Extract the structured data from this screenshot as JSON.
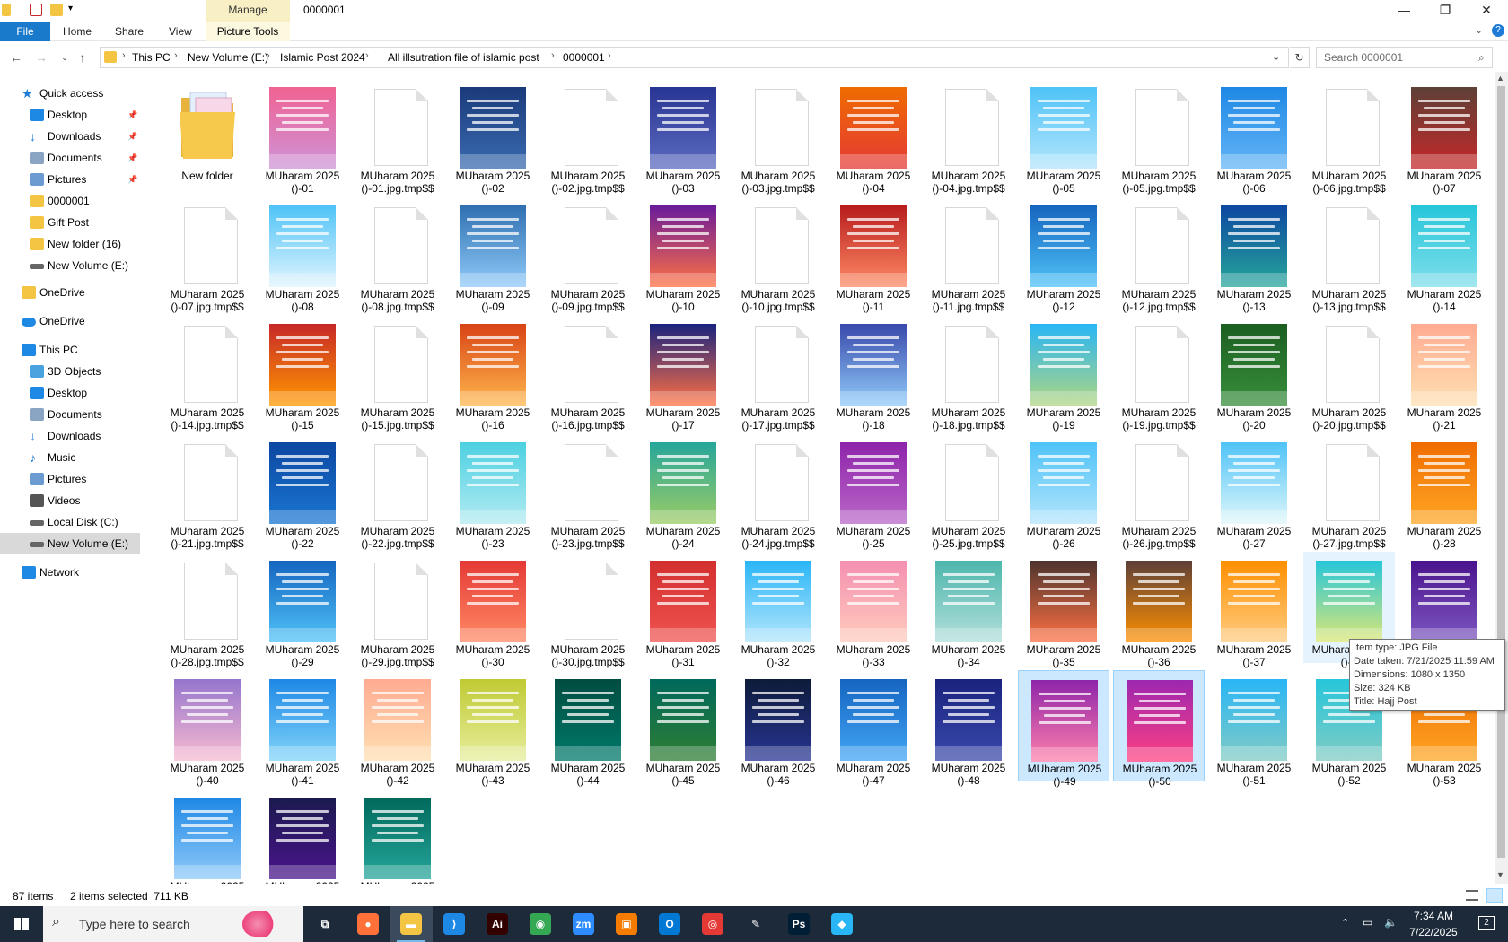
{
  "window": {
    "manage_tab": "Manage",
    "title": "0000001",
    "minimize": "—",
    "maximize": "❐",
    "close": "✕"
  },
  "ribbon": {
    "file": "File",
    "home": "Home",
    "share": "Share",
    "view": "View",
    "picture_tools": "Picture Tools"
  },
  "address": {
    "crumbs": [
      "This PC",
      "New Volume (E:)",
      "Islamic Post 2024",
      "All illsutration file of islamic post",
      "0000001"
    ],
    "search_placeholder": "Search 0000001"
  },
  "navpane": {
    "items": [
      {
        "label": "Quick access",
        "icon": "star-icon",
        "color": "#1e7bd6",
        "indent": 0,
        "pinned": false
      },
      {
        "label": "Desktop",
        "icon": "desktop-icon",
        "color": "#1e88e5",
        "indent": 1,
        "pinned": true
      },
      {
        "label": "Downloads",
        "icon": "download-icon",
        "color": "#1e7bd6",
        "indent": 1,
        "pinned": true
      },
      {
        "label": "Documents",
        "icon": "document-icon",
        "color": "#8aa4c4",
        "indent": 1,
        "pinned": true
      },
      {
        "label": "Pictures",
        "icon": "pictures-icon",
        "color": "#6c9bd2",
        "indent": 1,
        "pinned": true
      },
      {
        "label": "0000001",
        "icon": "folder-icon",
        "color": "#f4c542",
        "indent": 1,
        "pinned": false
      },
      {
        "label": "Gift Post",
        "icon": "folder-icon",
        "color": "#f4c542",
        "indent": 1,
        "pinned": false
      },
      {
        "label": "New folder (16)",
        "icon": "folder-icon",
        "color": "#f4c542",
        "indent": 1,
        "pinned": false
      },
      {
        "label": "New Volume (E:)",
        "icon": "drive-icon",
        "color": "#666666",
        "indent": 1,
        "pinned": false
      },
      {
        "label": "OneDrive",
        "icon": "folder-icon",
        "color": "#f4c542",
        "indent": 0,
        "pinned": false
      },
      {
        "label": "OneDrive",
        "icon": "cloud-icon",
        "color": "#1e88e5",
        "indent": 0,
        "pinned": false
      },
      {
        "label": "This PC",
        "icon": "computer-icon",
        "color": "#1e88e5",
        "indent": 0,
        "pinned": false
      },
      {
        "label": "3D Objects",
        "icon": "cube-icon",
        "color": "#4aa3df",
        "indent": 1,
        "pinned": false
      },
      {
        "label": "Desktop",
        "icon": "desktop-icon",
        "color": "#1e88e5",
        "indent": 1,
        "pinned": false
      },
      {
        "label": "Documents",
        "icon": "document-icon",
        "color": "#8aa4c4",
        "indent": 1,
        "pinned": false
      },
      {
        "label": "Downloads",
        "icon": "download-icon",
        "color": "#1e7bd6",
        "indent": 1,
        "pinned": false
      },
      {
        "label": "Music",
        "icon": "music-icon",
        "color": "#1e7bd6",
        "indent": 1,
        "pinned": false
      },
      {
        "label": "Pictures",
        "icon": "pictures-icon",
        "color": "#6c9bd2",
        "indent": 1,
        "pinned": false
      },
      {
        "label": "Videos",
        "icon": "video-icon",
        "color": "#555555",
        "indent": 1,
        "pinned": false
      },
      {
        "label": "Local Disk (C:)",
        "icon": "drive-icon",
        "color": "#666666",
        "indent": 1,
        "pinned": false
      },
      {
        "label": "New Volume (E:)",
        "icon": "drive-icon",
        "color": "#666666",
        "indent": 1,
        "pinned": false,
        "selected": true
      },
      {
        "label": "Network",
        "icon": "network-icon",
        "color": "#1e88e5",
        "indent": 0,
        "pinned": false
      }
    ]
  },
  "files": [
    {
      "name": "New folder",
      "kind": "folder"
    },
    {
      "name": "MUharam 2025\n()-01",
      "kind": "img",
      "colors": [
        "#f06292",
        "#ce93d8"
      ]
    },
    {
      "name": "MUharam 2025\n()-01.jpg.tmp$$",
      "kind": "blank"
    },
    {
      "name": "MUharam 2025\n()-02",
      "kind": "img",
      "colors": [
        "#1a3a7a",
        "#3a6bb0"
      ]
    },
    {
      "name": "MUharam 2025\n()-02.jpg.tmp$$",
      "kind": "blank"
    },
    {
      "name": "MUharam 2025\n()-03",
      "kind": "img",
      "colors": [
        "#283593",
        "#5c6bc0"
      ]
    },
    {
      "name": "MUharam 2025\n()-03.jpg.tmp$$",
      "kind": "blank"
    },
    {
      "name": "MUharam 2025\n()-04",
      "kind": "img",
      "colors": [
        "#ef6c00",
        "#e53935"
      ]
    },
    {
      "name": "MUharam 2025\n()-04.jpg.tmp$$",
      "kind": "blank"
    },
    {
      "name": "MUharam 2025\n()-05",
      "kind": "img",
      "colors": [
        "#4fc3f7",
        "#b3e5fc"
      ]
    },
    {
      "name": "MUharam 2025\n()-05.jpg.tmp$$",
      "kind": "blank"
    },
    {
      "name": "MUharam 2025\n()-06",
      "kind": "img",
      "colors": [
        "#1e88e5",
        "#64b5f6"
      ]
    },
    {
      "name": "MUharam 2025\n()-06.jpg.tmp$$",
      "kind": "blank"
    },
    {
      "name": "MUharam 2025\n()-07",
      "kind": "img",
      "colors": [
        "#5d4037",
        "#c62828"
      ]
    },
    {
      "name": "MUharam 2025\n()-07.jpg.tmp$$",
      "kind": "blank"
    },
    {
      "name": "MUharam 2025\n()-08",
      "kind": "img",
      "colors": [
        "#4fc3f7",
        "#e1f5fe"
      ]
    },
    {
      "name": "MUharam 2025\n()-08.jpg.tmp$$",
      "kind": "blank"
    },
    {
      "name": "MUharam 2025\n()-09",
      "kind": "img",
      "colors": [
        "#2f6fb0",
        "#90caf9"
      ]
    },
    {
      "name": "MUharam 2025\n()-09.jpg.tmp$$",
      "kind": "blank"
    },
    {
      "name": "MUharam 2025\n()-10",
      "kind": "img",
      "colors": [
        "#6a1b9a",
        "#ff7043"
      ]
    },
    {
      "name": "MUharam 2025\n()-10.jpg.tmp$$",
      "kind": "blank"
    },
    {
      "name": "MUharam 2025\n()-11",
      "kind": "img",
      "colors": [
        "#b71c1c",
        "#ff8a65"
      ]
    },
    {
      "name": "MUharam 2025\n()-11.jpg.tmp$$",
      "kind": "blank"
    },
    {
      "name": "MUharam 2025\n()-12",
      "kind": "img",
      "colors": [
        "#1565c0",
        "#4fc3f7"
      ]
    },
    {
      "name": "MUharam 2025\n()-12.jpg.tmp$$",
      "kind": "blank"
    },
    {
      "name": "MUharam 2025\n()-13",
      "kind": "img",
      "colors": [
        "#0d47a1",
        "#26a69a"
      ]
    },
    {
      "name": "MUharam 2025\n()-13.jpg.tmp$$",
      "kind": "blank"
    },
    {
      "name": "MUharam 2025\n()-14",
      "kind": "img",
      "colors": [
        "#26c6da",
        "#80deea"
      ]
    },
    {
      "name": "MUharam 2025\n()-14.jpg.tmp$$",
      "kind": "blank"
    },
    {
      "name": "MUharam 2025\n()-15",
      "kind": "img",
      "colors": [
        "#c62828",
        "#ff9800"
      ]
    },
    {
      "name": "MUharam 2025\n()-15.jpg.tmp$$",
      "kind": "blank"
    },
    {
      "name": "MUharam 2025\n()-16",
      "kind": "img",
      "colors": [
        "#d84315",
        "#ffb74d"
      ]
    },
    {
      "name": "MUharam 2025\n()-16.jpg.tmp$$",
      "kind": "blank"
    },
    {
      "name": "MUharam 2025\n()-17",
      "kind": "img",
      "colors": [
        "#1a237e",
        "#ff7043"
      ]
    },
    {
      "name": "MUharam 2025\n()-17.jpg.tmp$$",
      "kind": "blank"
    },
    {
      "name": "MUharam 2025\n()-18",
      "kind": "img",
      "colors": [
        "#3949ab",
        "#90caf9"
      ]
    },
    {
      "name": "MUharam 2025\n()-18.jpg.tmp$$",
      "kind": "blank"
    },
    {
      "name": "MUharam 2025\n()-19",
      "kind": "img",
      "colors": [
        "#29b6f6",
        "#aed581"
      ]
    },
    {
      "name": "MUharam 2025\n()-19.jpg.tmp$$",
      "kind": "blank"
    },
    {
      "name": "MUharam 2025\n()-20",
      "kind": "img",
      "colors": [
        "#1b5e20",
        "#388e3c"
      ]
    },
    {
      "name": "MUharam 2025\n()-20.jpg.tmp$$",
      "kind": "blank"
    },
    {
      "name": "MUharam 2025\n()-21",
      "kind": "img",
      "colors": [
        "#ffab91",
        "#ffe0b2"
      ]
    },
    {
      "name": "MUharam 2025\n()-21.jpg.tmp$$",
      "kind": "blank"
    },
    {
      "name": "MUharam 2025\n()-22",
      "kind": "img",
      "colors": [
        "#0d47a1",
        "#1976d2"
      ]
    },
    {
      "name": "MUharam 2025\n()-22.jpg.tmp$$",
      "kind": "blank"
    },
    {
      "name": "MUharam 2025\n()-23",
      "kind": "img",
      "colors": [
        "#4dd0e1",
        "#b2ebf2"
      ]
    },
    {
      "name": "MUharam 2025\n()-23.jpg.tmp$$",
      "kind": "blank"
    },
    {
      "name": "MUharam 2025\n()-24",
      "kind": "img",
      "colors": [
        "#26a69a",
        "#9ccc65"
      ]
    },
    {
      "name": "MUharam 2025\n()-24.jpg.tmp$$",
      "kind": "blank"
    },
    {
      "name": "MUharam 2025\n()-25",
      "kind": "img",
      "colors": [
        "#8e24aa",
        "#ba68c8"
      ]
    },
    {
      "name": "MUharam 2025\n()-25.jpg.tmp$$",
      "kind": "blank"
    },
    {
      "name": "MUharam 2025\n()-26",
      "kind": "img",
      "colors": [
        "#4fc3f7",
        "#b3e5fc"
      ]
    },
    {
      "name": "MUharam 2025\n()-26.jpg.tmp$$",
      "kind": "blank"
    },
    {
      "name": "MUharam 2025\n()-27",
      "kind": "img",
      "colors": [
        "#4fc3f7",
        "#e0f7fa"
      ]
    },
    {
      "name": "MUharam 2025\n()-27.jpg.tmp$$",
      "kind": "blank"
    },
    {
      "name": "MUharam 2025\n()-28",
      "kind": "img",
      "colors": [
        "#ef6c00",
        "#ffa726"
      ]
    },
    {
      "name": "MUharam 2025\n()-28.jpg.tmp$$",
      "kind": "blank"
    },
    {
      "name": "MUharam 2025\n()-29",
      "kind": "img",
      "colors": [
        "#1565c0",
        "#4fc3f7"
      ]
    },
    {
      "name": "MUharam 2025\n()-29.jpg.tmp$$",
      "kind": "blank"
    },
    {
      "name": "MUharam 2025\n()-30",
      "kind": "img",
      "colors": [
        "#e53935",
        "#ff8a65"
      ]
    },
    {
      "name": "MUharam 2025\n()-30.jpg.tmp$$",
      "kind": "blank"
    },
    {
      "name": "MUharam 2025\n()-31",
      "kind": "img",
      "colors": [
        "#d32f2f",
        "#ef5350"
      ]
    },
    {
      "name": "MUharam 2025\n()-32",
      "kind": "img",
      "colors": [
        "#29b6f6",
        "#b3e5fc"
      ]
    },
    {
      "name": "MUharam 2025\n()-33",
      "kind": "img",
      "colors": [
        "#f48fb1",
        "#ffccbc"
      ]
    },
    {
      "name": "MUharam 2025\n()-34",
      "kind": "img",
      "colors": [
        "#4db6ac",
        "#b2dfdb"
      ]
    },
    {
      "name": "MUharam 2025\n()-35",
      "kind": "img",
      "colors": [
        "#4e342e",
        "#ff7043"
      ]
    },
    {
      "name": "MUharam 2025\n()-36",
      "kind": "img",
      "colors": [
        "#5d4037",
        "#ff8f00"
      ]
    },
    {
      "name": "MUharam 2025\n()-37",
      "kind": "img",
      "colors": [
        "#ff8f00",
        "#ffcc80"
      ]
    },
    {
      "name": "MUharam 2025\n()-3",
      "kind": "img",
      "colors": [
        "#26c6da",
        "#dce775"
      ],
      "hovered": true
    },
    {
      "name": "MUharam 2025\n()-39",
      "kind": "img",
      "colors": [
        "#4a148c",
        "#7e57c2"
      ]
    },
    {
      "name": "MUharam 2025\n()-40",
      "kind": "img",
      "colors": [
        "#9575cd",
        "#f8bbd0"
      ]
    },
    {
      "name": "MUharam 2025\n()-41",
      "kind": "img",
      "colors": [
        "#1e88e5",
        "#81d4fa"
      ]
    },
    {
      "name": "MUharam 2025\n()-42",
      "kind": "img",
      "colors": [
        "#ffab91",
        "#ffe0b2"
      ]
    },
    {
      "name": "MUharam 2025\n()-43",
      "kind": "img",
      "colors": [
        "#c0ca33",
        "#e6ee9c"
      ]
    },
    {
      "name": "MUharam 2025\n()-44",
      "kind": "img",
      "colors": [
        "#004d40",
        "#00796b"
      ]
    },
    {
      "name": "MUharam 2025\n()-45",
      "kind": "img",
      "colors": [
        "#00695c",
        "#2e7d32"
      ]
    },
    {
      "name": "MUharam 2025\n()-46",
      "kind": "img",
      "colors": [
        "#0d1b3a",
        "#283593"
      ]
    },
    {
      "name": "MUharam 2025\n()-47",
      "kind": "img",
      "colors": [
        "#1565c0",
        "#42a5f5"
      ]
    },
    {
      "name": "MUharam 2025\n()-48",
      "kind": "img",
      "colors": [
        "#1a237e",
        "#3949ab"
      ]
    },
    {
      "name": "MUharam 2025\n()-49",
      "kind": "img",
      "colors": [
        "#8e24aa",
        "#ff80ab"
      ],
      "selected": true
    },
    {
      "name": "MUharam 2025\n()-50",
      "kind": "img",
      "colors": [
        "#9c27b0",
        "#ff4081"
      ],
      "selected": true
    },
    {
      "name": "MUharam 2025\n()-51",
      "kind": "img",
      "colors": [
        "#29b6f6",
        "#80cbc4"
      ]
    },
    {
      "name": "MUharam 2025\n()-52",
      "kind": "img",
      "colors": [
        "#26c6da",
        "#80cbc4"
      ]
    },
    {
      "name": "MUharam 2025\n()-53",
      "kind": "img",
      "colors": [
        "#ef6c00",
        "#ffa726"
      ]
    },
    {
      "name": "MUharam 2025",
      "kind": "img",
      "colors": [
        "#1e88e5",
        "#90caf9"
      ]
    },
    {
      "name": "MUharam 2025",
      "kind": "img",
      "colors": [
        "#1a1a4e",
        "#4a148c"
      ]
    },
    {
      "name": "MUharam 2025",
      "kind": "img",
      "colors": [
        "#00695c",
        "#26a69a"
      ]
    }
  ],
  "tooltip": {
    "lines": [
      "Item type: JPG File",
      "Date taken: 7/21/2025 11:59 AM",
      "Dimensions: 1080 x 1350",
      "Size: 324 KB",
      "Title: Hajj Post"
    ]
  },
  "status": {
    "items": "87 items",
    "selected": "2 items selected  711 KB"
  },
  "taskbar": {
    "search_placeholder": "Type here to search",
    "time": "7:34 AM",
    "date": "7/22/2025",
    "notification_count": "2",
    "apps": [
      {
        "name": "task-view",
        "glyph": "⧉",
        "color": "#1c2a3a"
      },
      {
        "name": "firefox",
        "glyph": "●",
        "color": "#ff7139"
      },
      {
        "name": "file-explorer",
        "glyph": "▬",
        "color": "#f4c542",
        "active": true
      },
      {
        "name": "vscode",
        "glyph": "⟩",
        "color": "#1e88e5"
      },
      {
        "name": "illustrator",
        "glyph": "Ai",
        "color": "#330000"
      },
      {
        "name": "chrome",
        "glyph": "◉",
        "color": "#34a853"
      },
      {
        "name": "zoom",
        "glyph": "zm",
        "color": "#2d8cff"
      },
      {
        "name": "app-orange",
        "glyph": "▣",
        "color": "#f57c00"
      },
      {
        "name": "outlook",
        "glyph": "O",
        "color": "#0078d4"
      },
      {
        "name": "creative-cloud",
        "glyph": "◎",
        "color": "#e53935"
      },
      {
        "name": "pen-tool",
        "glyph": "✎",
        "color": "#1c2a3a"
      },
      {
        "name": "photoshop",
        "glyph": "Ps",
        "color": "#001e36"
      },
      {
        "name": "app-cube",
        "glyph": "◆",
        "color": "#29b6f6"
      }
    ]
  }
}
